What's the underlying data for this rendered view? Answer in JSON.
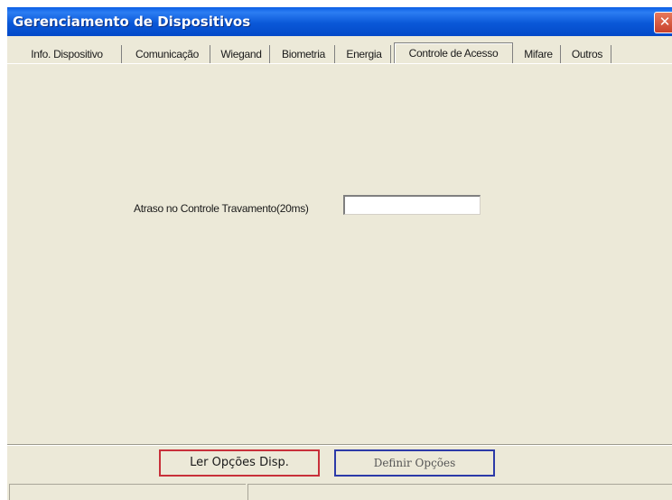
{
  "window": {
    "title": "Gerenciamento de Dispositivos",
    "close_glyph": "✕"
  },
  "tabs": [
    {
      "label": "Info. Dispositivo"
    },
    {
      "label": "Comunicação"
    },
    {
      "label": "Wiegand"
    },
    {
      "label": "Biometria"
    },
    {
      "label": "Energia"
    },
    {
      "label": "Controle de Acesso",
      "active": true
    },
    {
      "label": "Mifare"
    },
    {
      "label": "Outros"
    }
  ],
  "access_control": {
    "lock_delay_label": "Atraso no Controle Travamento(20ms)",
    "lock_delay_value": ""
  },
  "buttons": {
    "read_label": "Ler Opções Disp.",
    "set_label": "Definir Opções"
  },
  "colors": {
    "titlebar": "#0a58d8",
    "window_bg": "#ece9d8",
    "read_button_border": "#c8303a",
    "set_button_border": "#2c3aa8"
  },
  "icons": {
    "close": "close-icon"
  }
}
